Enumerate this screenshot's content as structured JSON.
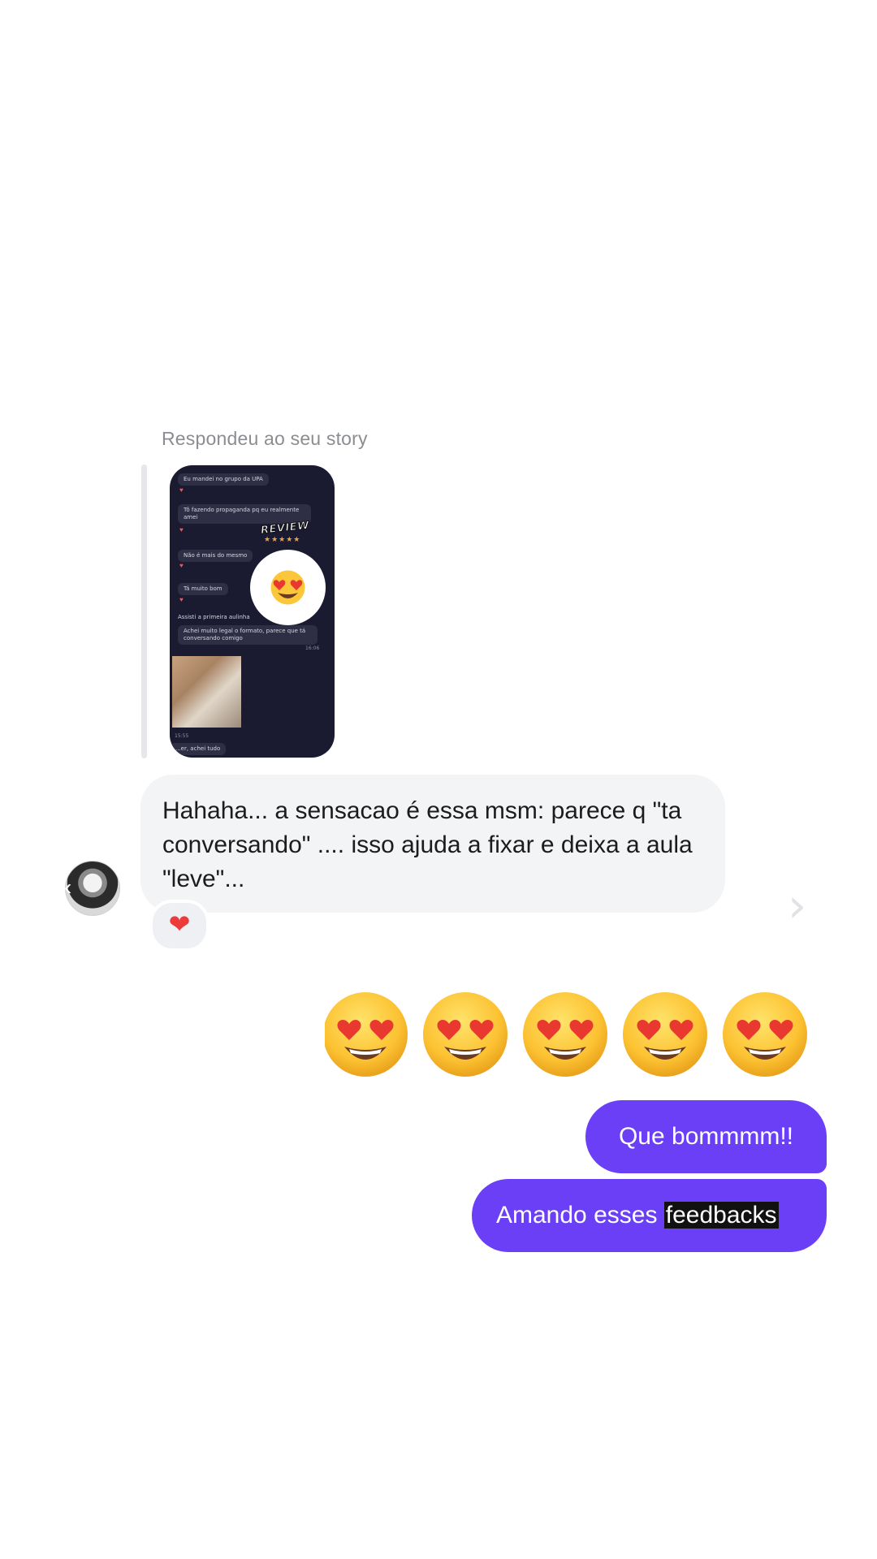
{
  "conversation": {
    "reply_context": {
      "label": "Respondeu ao seu story",
      "story_preview": {
        "messages": [
          "Eu mandei no grupo da UPA",
          "Tô fazendo propaganda pq eu realmente amei",
          "Não é mais do mesmo",
          "Tá muito bom",
          "Assisti a primeira aulinha",
          "Achei muito legal o formato, parece que tá conversando comigo",
          "...er, achei tudo"
        ],
        "times": [
          "16:06",
          "15:55",
          "16:16"
        ],
        "sticker_text": "REVIEW",
        "sticker_stars": "★★★★★"
      }
    },
    "incoming": {
      "text": "Hahaha... a sensacao é essa msm: parece q \"ta conversando\" .... isso ajuda a fixar e deixa a aula \"leve\"...",
      "reaction": "❤"
    },
    "outgoing": {
      "emoji_count_message": "heart-eyes-emoji x5",
      "message_1": "Que bommmm!!",
      "message_2_prefix": "Amando esses ",
      "message_2_highlight": "feedbacks"
    },
    "nav": {
      "prev_arrow": "‹",
      "next_arrow": "›"
    }
  },
  "colors": {
    "outgoing_bubble": "#6a3ff6",
    "incoming_bubble": "#f3f4f6",
    "reaction_heart": "#ec3b3b",
    "story_background": "#1a1a31"
  }
}
